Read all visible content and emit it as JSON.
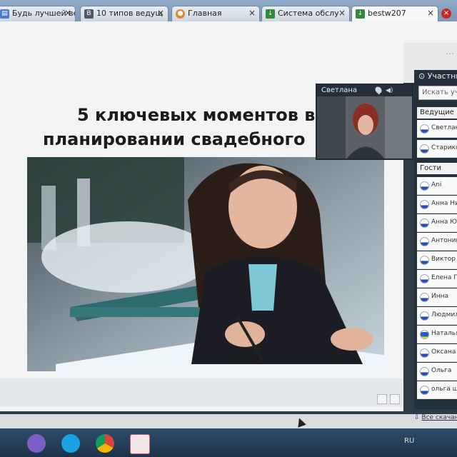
{
  "browser": {
    "tabs": [
      {
        "label": "Будь лучшей ве",
        "icon": "page-icon"
      },
      {
        "label": "10 типов ведущ",
        "icon": "blog-icon"
      },
      {
        "label": "Главная",
        "icon": "home-icon"
      },
      {
        "label": "Система обслу",
        "icon": "download-icon"
      },
      {
        "label": "bestw207",
        "icon": "download-icon"
      }
    ],
    "close_symbol": "×"
  },
  "slide": {
    "title_line1": "5 ключевых моментов в",
    "title_line2": "планировании свадебного"
  },
  "webcam": {
    "name": "Светлана"
  },
  "participants": {
    "title": "Участники",
    "search_placeholder": "Искать участника",
    "hosts_header": "Ведущие вебинара",
    "hosts": [
      {
        "name": "Светлана",
        "flag": "ru"
      },
      {
        "name": "Старикова",
        "flag": "ru"
      }
    ],
    "guests_header": "Гости",
    "guests": [
      {
        "name": "Ani",
        "flag": "ru"
      },
      {
        "name": "Анна Ник",
        "flag": "ru"
      },
      {
        "name": "Анна Юш",
        "flag": "ru"
      },
      {
        "name": "Антонина",
        "flag": "ru"
      },
      {
        "name": "Виктор А",
        "flag": "ru"
      },
      {
        "name": "Елена Пр",
        "flag": "ru"
      },
      {
        "name": "Инна",
        "flag": "ru"
      },
      {
        "name": "Людмила",
        "flag": "ru"
      },
      {
        "name": "Наталья",
        "flag": "ua"
      },
      {
        "name": "Оксана Кол",
        "flag": "ru"
      },
      {
        "name": "Ольга",
        "flag": "ru"
      },
      {
        "name": "ольга шуры",
        "flag": "ru"
      }
    ],
    "footer_link": "Все скачан"
  },
  "taskbar": {
    "lang": "RU"
  },
  "colors": {
    "flag_white": "#ffffff",
    "flag_blue": "#1c4fc1",
    "flag_red": "#d52b1e",
    "ua_blue": "#1f5fd1",
    "ua_yellow": "#f5d300"
  }
}
